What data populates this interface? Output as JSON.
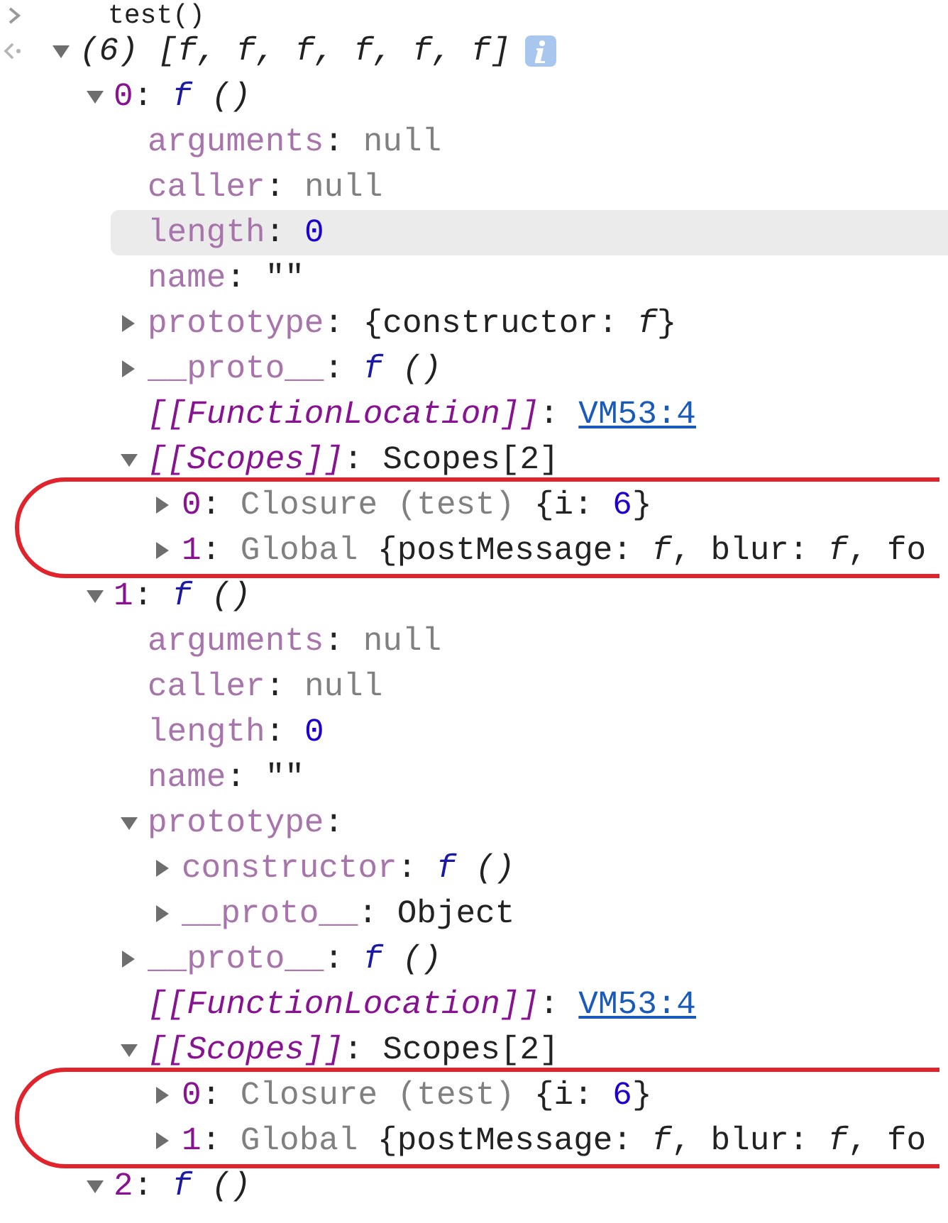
{
  "console": [
    {
      "kind": "input",
      "text": "test()"
    },
    {
      "kind": "result",
      "tree": {
        "tokens": [
          {
            "kind": "italic",
            "text": "(6) [f, f, f, f, f, f]"
          }
        ],
        "expanded": true,
        "children": [
          {
            "tokens": [
              {
                "kind": "index",
                "text": "0"
              },
              {
                "kind": "text",
                "text": ": "
              },
              {
                "kind": "func",
                "text": "f"
              },
              {
                "kind": "italic",
                "text": " ()"
              }
            ],
            "expanded": true,
            "children": [
              {
                "tokens": [
                  {
                    "kind": "key",
                    "text": "arguments"
                  },
                  {
                    "kind": "text",
                    "text": ": "
                  },
                  {
                    "kind": "null",
                    "text": "null"
                  }
                ]
              },
              {
                "tokens": [
                  {
                    "kind": "key",
                    "text": "caller"
                  },
                  {
                    "kind": "text",
                    "text": ": "
                  },
                  {
                    "kind": "null",
                    "text": "null"
                  }
                ]
              },
              {
                "tokens": [
                  {
                    "kind": "key",
                    "text": "length"
                  },
                  {
                    "kind": "text",
                    "text": ": "
                  },
                  {
                    "kind": "number",
                    "text": "0"
                  }
                ],
                "hovered": true
              },
              {
                "tokens": [
                  {
                    "kind": "key",
                    "text": "name"
                  },
                  {
                    "kind": "text",
                    "text": ": \"\""
                  }
                ]
              },
              {
                "tokens": [
                  {
                    "kind": "key",
                    "text": "prototype"
                  },
                  {
                    "kind": "text",
                    "text": ": {constructor: "
                  },
                  {
                    "kind": "italic",
                    "text": "f"
                  },
                  {
                    "kind": "text",
                    "text": "}"
                  }
                ],
                "expanded": false
              },
              {
                "tokens": [
                  {
                    "kind": "key",
                    "text": "__proto__"
                  },
                  {
                    "kind": "text",
                    "text": ": "
                  },
                  {
                    "kind": "func",
                    "text": "f"
                  },
                  {
                    "kind": "italic",
                    "text": " ()"
                  }
                ],
                "expanded": false
              },
              {
                "tokens": [
                  {
                    "kind": "internal",
                    "text": "[[FunctionLocation]]"
                  },
                  {
                    "kind": "text",
                    "text": ": "
                  },
                  {
                    "kind": "link",
                    "text": "VM53:4"
                  }
                ]
              },
              {
                "tokens": [
                  {
                    "kind": "internal",
                    "text": "[[Scopes]]"
                  },
                  {
                    "kind": "text",
                    "text": ": Scopes[2]"
                  }
                ],
                "expanded": true,
                "circled": true,
                "children": [
                  {
                    "tokens": [
                      {
                        "kind": "index",
                        "text": "0"
                      },
                      {
                        "kind": "text",
                        "text": ": "
                      },
                      {
                        "kind": "scope",
                        "text": "Closure (test)"
                      },
                      {
                        "kind": "text",
                        "text": " {i: "
                      },
                      {
                        "kind": "number",
                        "text": "6"
                      },
                      {
                        "kind": "text",
                        "text": "}"
                      }
                    ],
                    "expanded": false
                  },
                  {
                    "tokens": [
                      {
                        "kind": "index",
                        "text": "1"
                      },
                      {
                        "kind": "text",
                        "text": ": "
                      },
                      {
                        "kind": "scope",
                        "text": "Global"
                      },
                      {
                        "kind": "text",
                        "text": " {postMessage: "
                      },
                      {
                        "kind": "italic",
                        "text": "f"
                      },
                      {
                        "kind": "text",
                        "text": ", blur: "
                      },
                      {
                        "kind": "italic",
                        "text": "f"
                      },
                      {
                        "kind": "text",
                        "text": ", fo"
                      }
                    ],
                    "expanded": false
                  }
                ]
              }
            ]
          },
          {
            "tokens": [
              {
                "kind": "index",
                "text": "1"
              },
              {
                "kind": "text",
                "text": ": "
              },
              {
                "kind": "func",
                "text": "f"
              },
              {
                "kind": "italic",
                "text": " ()"
              }
            ],
            "expanded": true,
            "children": [
              {
                "tokens": [
                  {
                    "kind": "key",
                    "text": "arguments"
                  },
                  {
                    "kind": "text",
                    "text": ": "
                  },
                  {
                    "kind": "null",
                    "text": "null"
                  }
                ]
              },
              {
                "tokens": [
                  {
                    "kind": "key",
                    "text": "caller"
                  },
                  {
                    "kind": "text",
                    "text": ": "
                  },
                  {
                    "kind": "null",
                    "text": "null"
                  }
                ]
              },
              {
                "tokens": [
                  {
                    "kind": "key",
                    "text": "length"
                  },
                  {
                    "kind": "text",
                    "text": ": "
                  },
                  {
                    "kind": "number",
                    "text": "0"
                  }
                ]
              },
              {
                "tokens": [
                  {
                    "kind": "key",
                    "text": "name"
                  },
                  {
                    "kind": "text",
                    "text": ": \"\""
                  }
                ]
              },
              {
                "tokens": [
                  {
                    "kind": "key",
                    "text": "prototype"
                  },
                  {
                    "kind": "text",
                    "text": ":"
                  }
                ],
                "expanded": true,
                "children": [
                  {
                    "tokens": [
                      {
                        "kind": "key",
                        "text": "constructor"
                      },
                      {
                        "kind": "text",
                        "text": ": "
                      },
                      {
                        "kind": "func",
                        "text": "f"
                      },
                      {
                        "kind": "italic",
                        "text": " ()"
                      }
                    ],
                    "expanded": false
                  },
                  {
                    "tokens": [
                      {
                        "kind": "key",
                        "text": "__proto__"
                      },
                      {
                        "kind": "text",
                        "text": ": Object"
                      }
                    ],
                    "expanded": false
                  }
                ]
              },
              {
                "tokens": [
                  {
                    "kind": "key",
                    "text": "__proto__"
                  },
                  {
                    "kind": "text",
                    "text": ": "
                  },
                  {
                    "kind": "func",
                    "text": "f"
                  },
                  {
                    "kind": "italic",
                    "text": " ()"
                  }
                ],
                "expanded": false
              },
              {
                "tokens": [
                  {
                    "kind": "internal",
                    "text": "[[FunctionLocation]]"
                  },
                  {
                    "kind": "text",
                    "text": ": "
                  },
                  {
                    "kind": "link",
                    "text": "VM53:4"
                  }
                ]
              },
              {
                "tokens": [
                  {
                    "kind": "internal",
                    "text": "[[Scopes]]"
                  },
                  {
                    "kind": "text",
                    "text": ": Scopes[2]"
                  }
                ],
                "expanded": true,
                "circled": true,
                "children": [
                  {
                    "tokens": [
                      {
                        "kind": "index",
                        "text": "0"
                      },
                      {
                        "kind": "text",
                        "text": ": "
                      },
                      {
                        "kind": "scope",
                        "text": "Closure (test)"
                      },
                      {
                        "kind": "text",
                        "text": " {i: "
                      },
                      {
                        "kind": "number",
                        "text": "6"
                      },
                      {
                        "kind": "text",
                        "text": "}"
                      }
                    ],
                    "expanded": false
                  },
                  {
                    "tokens": [
                      {
                        "kind": "index",
                        "text": "1"
                      },
                      {
                        "kind": "text",
                        "text": ": "
                      },
                      {
                        "kind": "scope",
                        "text": "Global"
                      },
                      {
                        "kind": "text",
                        "text": " {postMessage: "
                      },
                      {
                        "kind": "italic",
                        "text": "f"
                      },
                      {
                        "kind": "text",
                        "text": ", blur: "
                      },
                      {
                        "kind": "italic",
                        "text": "f"
                      },
                      {
                        "kind": "text",
                        "text": ", fo"
                      }
                    ],
                    "expanded": false
                  }
                ]
              }
            ]
          },
          {
            "tokens": [
              {
                "kind": "index",
                "text": "2"
              },
              {
                "kind": "text",
                "text": ": "
              },
              {
                "kind": "func",
                "text": "f"
              },
              {
                "kind": "italic",
                "text": " ()"
              }
            ],
            "expanded": true
          }
        ]
      }
    }
  ]
}
